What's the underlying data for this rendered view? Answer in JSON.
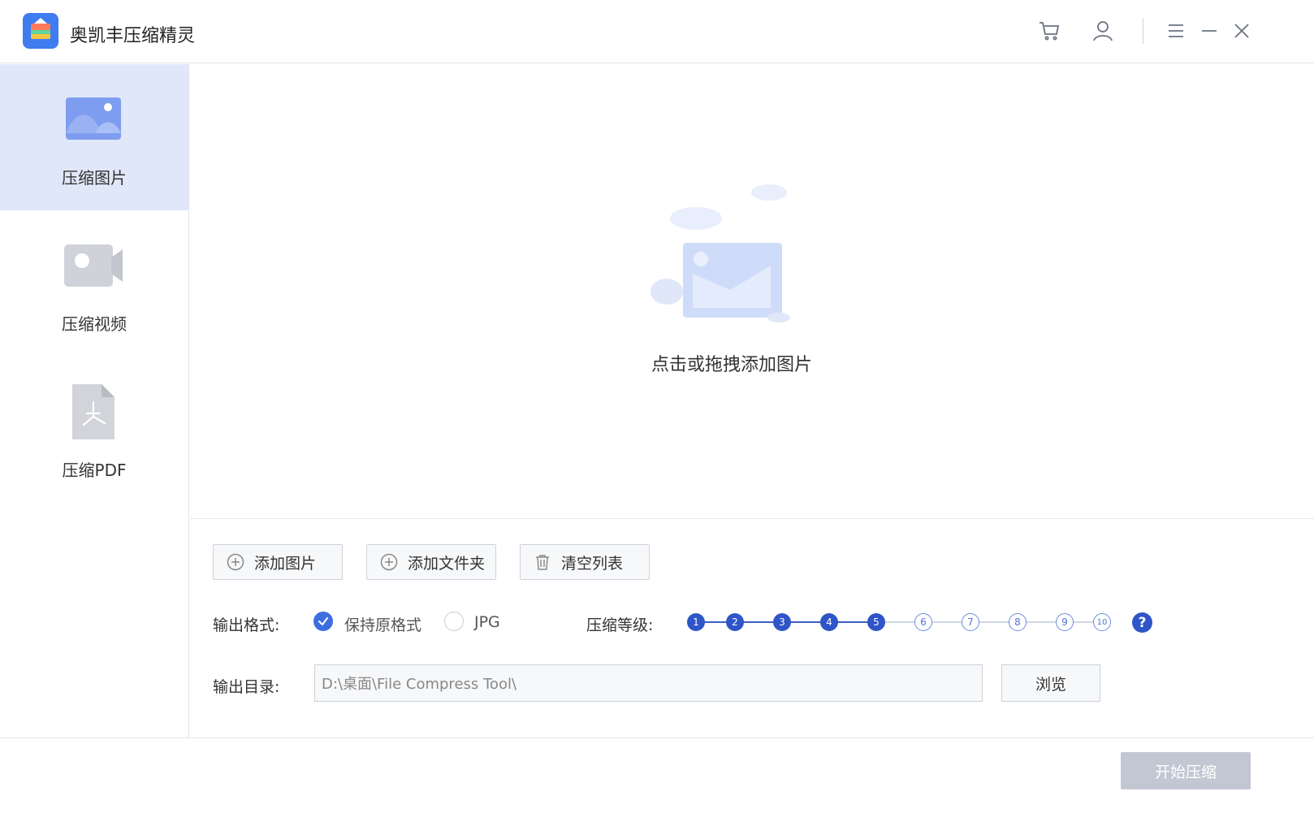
{
  "app": {
    "title": "奥凯丰压缩精灵",
    "accent": "#2f55c8"
  },
  "titlebar": {
    "icons": [
      "cart-icon",
      "user-icon",
      "menu-icon",
      "minimize-icon",
      "close-icon"
    ]
  },
  "sidebar": {
    "items": [
      {
        "label": "压缩图片",
        "icon": "image-icon",
        "active": true
      },
      {
        "label": "压缩视频",
        "icon": "video-icon",
        "active": false
      },
      {
        "label": "压缩PDF",
        "icon": "pdf-icon",
        "active": false
      }
    ]
  },
  "dropzone": {
    "text": "点击或拖拽添加图片"
  },
  "toolbar": {
    "add_image": "添加图片",
    "add_folder": "添加文件夹",
    "clear_list": "清空列表"
  },
  "output_format": {
    "label": "输出格式:",
    "options": [
      {
        "label": "保持原格式",
        "selected": true
      },
      {
        "label": "JPG",
        "selected": false
      }
    ]
  },
  "compression_level": {
    "label": "压缩等级:",
    "levels": [
      "1",
      "2",
      "3",
      "4",
      "5",
      "6",
      "7",
      "8",
      "9",
      "10"
    ],
    "selected": 5,
    "help": "?"
  },
  "output_dir": {
    "label": "输出目录:",
    "value": "D:\\桌面\\File Compress Tool\\",
    "browse": "浏览"
  },
  "start_button": "开始压缩"
}
